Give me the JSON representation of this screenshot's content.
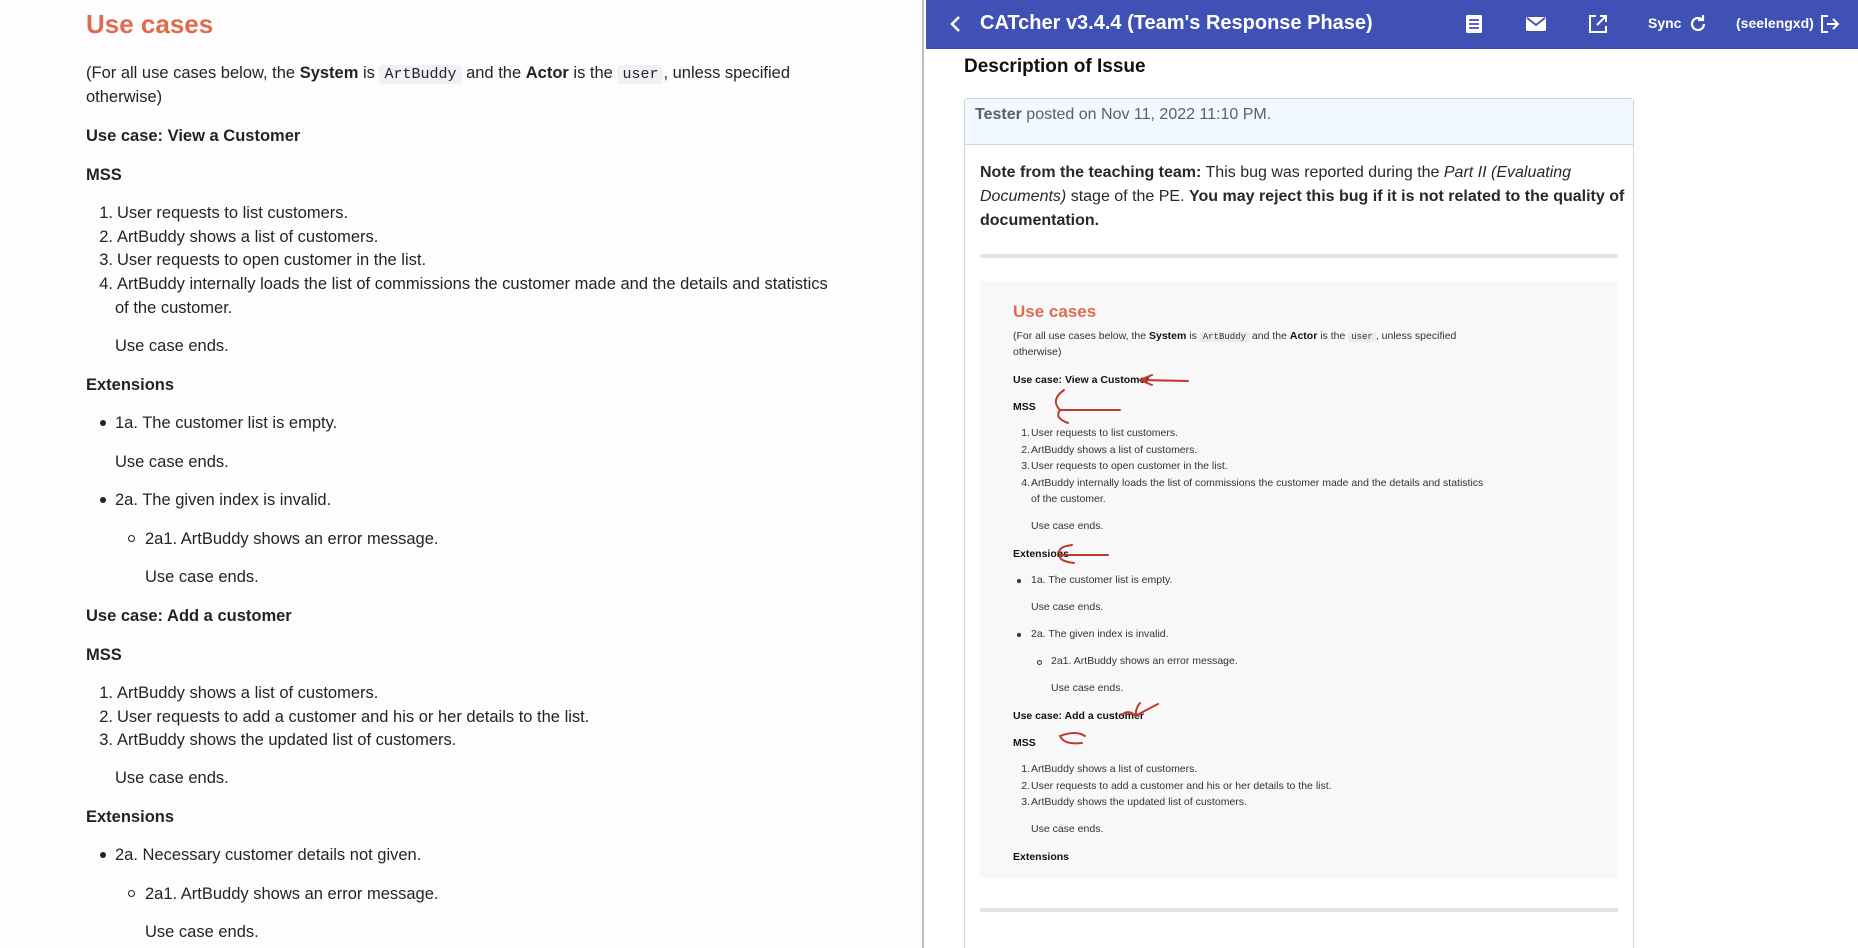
{
  "doc": {
    "title": "Use cases",
    "intro_pre": "(For all use cases below, the ",
    "system_word": "System",
    "is_word": " is ",
    "system_code": "ArtBuddy",
    "and_the": " and the ",
    "actor_word": "Actor",
    "is_the": " is the ",
    "actor_code": "user",
    "intro_post": ", unless specified",
    "intro_line2": "otherwise)",
    "uc1_title": "Use case: View a Customer",
    "mss": "MSS",
    "uc1_steps": [
      "User requests to list customers.",
      "ArtBuddy shows a list of customers.",
      "User requests to open customer in the list.",
      "ArtBuddy internally loads the list of commissions the customer made and the details and statistics"
    ],
    "uc1_step4_line2": "of the customer.",
    "use_case_ends": "Use case ends.",
    "extensions": "Extensions",
    "ext_1a": "1a. The customer list is empty.",
    "ext_2a": "2a. The given index is invalid.",
    "ext_2a1": "2a1. ArtBuddy shows an error message.",
    "uc2_title": "Use case: Add a customer",
    "uc2_steps": [
      "ArtBuddy shows a list of customers.",
      "User requests to add a customer and his or her details to the list.",
      "ArtBuddy shows the updated list of customers."
    ],
    "uc2_ext_2a": "2a. Necessary customer details not given."
  },
  "app": {
    "title": "CATcher v3.4.4  (Team's Response Phase)",
    "sync_label": "Sync",
    "user_label": "(seelengxd)",
    "icons": [
      "back-arrow-icon",
      "list-icon",
      "mail-icon",
      "open-external-icon",
      "refresh-icon",
      "logout-icon"
    ],
    "brand_color": "#3f51b5"
  },
  "issue": {
    "heading": "Description of Issue",
    "author": "Tester",
    "posted": " posted on Nov 11, 2022 11:10 PM.",
    "note_label": "Note from the teaching team:",
    "note_text1": " This bug was reported during the ",
    "note_italic": "Part II (Evaluating",
    "note_italic2": "Documents)",
    "note_text2": " stage of the PE. ",
    "note_bold": "You may reject this bug if it is not related to the quality of",
    "note_bold2": "documentation."
  },
  "annotation_color": "#c0392b"
}
